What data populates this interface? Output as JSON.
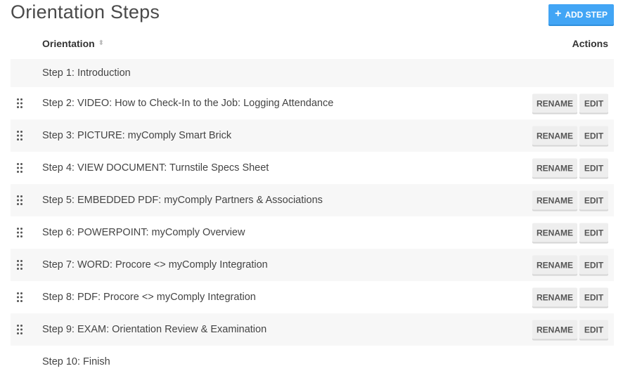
{
  "page": {
    "title": "Orientation Steps",
    "add_button": {
      "icon": "plus-icon",
      "label": "ADD STEP",
      "color": "#42a5f5"
    }
  },
  "table": {
    "headers": {
      "orientation": "Orientation",
      "sort_icon": "sort-icon",
      "actions": "Actions"
    },
    "action_labels": {
      "rename": "RENAME",
      "edit": "EDIT"
    },
    "rows": [
      {
        "label": "Step 1: Introduction",
        "draggable": false,
        "actions": false
      },
      {
        "label": "Step 2: VIDEO: How to Check-In to the Job: Logging Attendance",
        "draggable": true,
        "actions": true
      },
      {
        "label": "Step 3: PICTURE: myComply Smart Brick",
        "draggable": true,
        "actions": true
      },
      {
        "label": "Step 4: VIEW DOCUMENT: Turnstile Specs Sheet",
        "draggable": true,
        "actions": true
      },
      {
        "label": "Step 5: EMBEDDED PDF: myComply Partners & Associations",
        "draggable": true,
        "actions": true
      },
      {
        "label": "Step 6: POWERPOINT: myComply Overview",
        "draggable": true,
        "actions": true
      },
      {
        "label": "Step 7: WORD: Procore <> myComply Integration",
        "draggable": true,
        "actions": true
      },
      {
        "label": "Step 8: PDF: Procore <> myComply Integration",
        "draggable": true,
        "actions": true
      },
      {
        "label": "Step 9: EXAM: Orientation Review & Examination",
        "draggable": true,
        "actions": true
      },
      {
        "label": "Step 10: Finish",
        "draggable": false,
        "actions": false
      }
    ]
  }
}
